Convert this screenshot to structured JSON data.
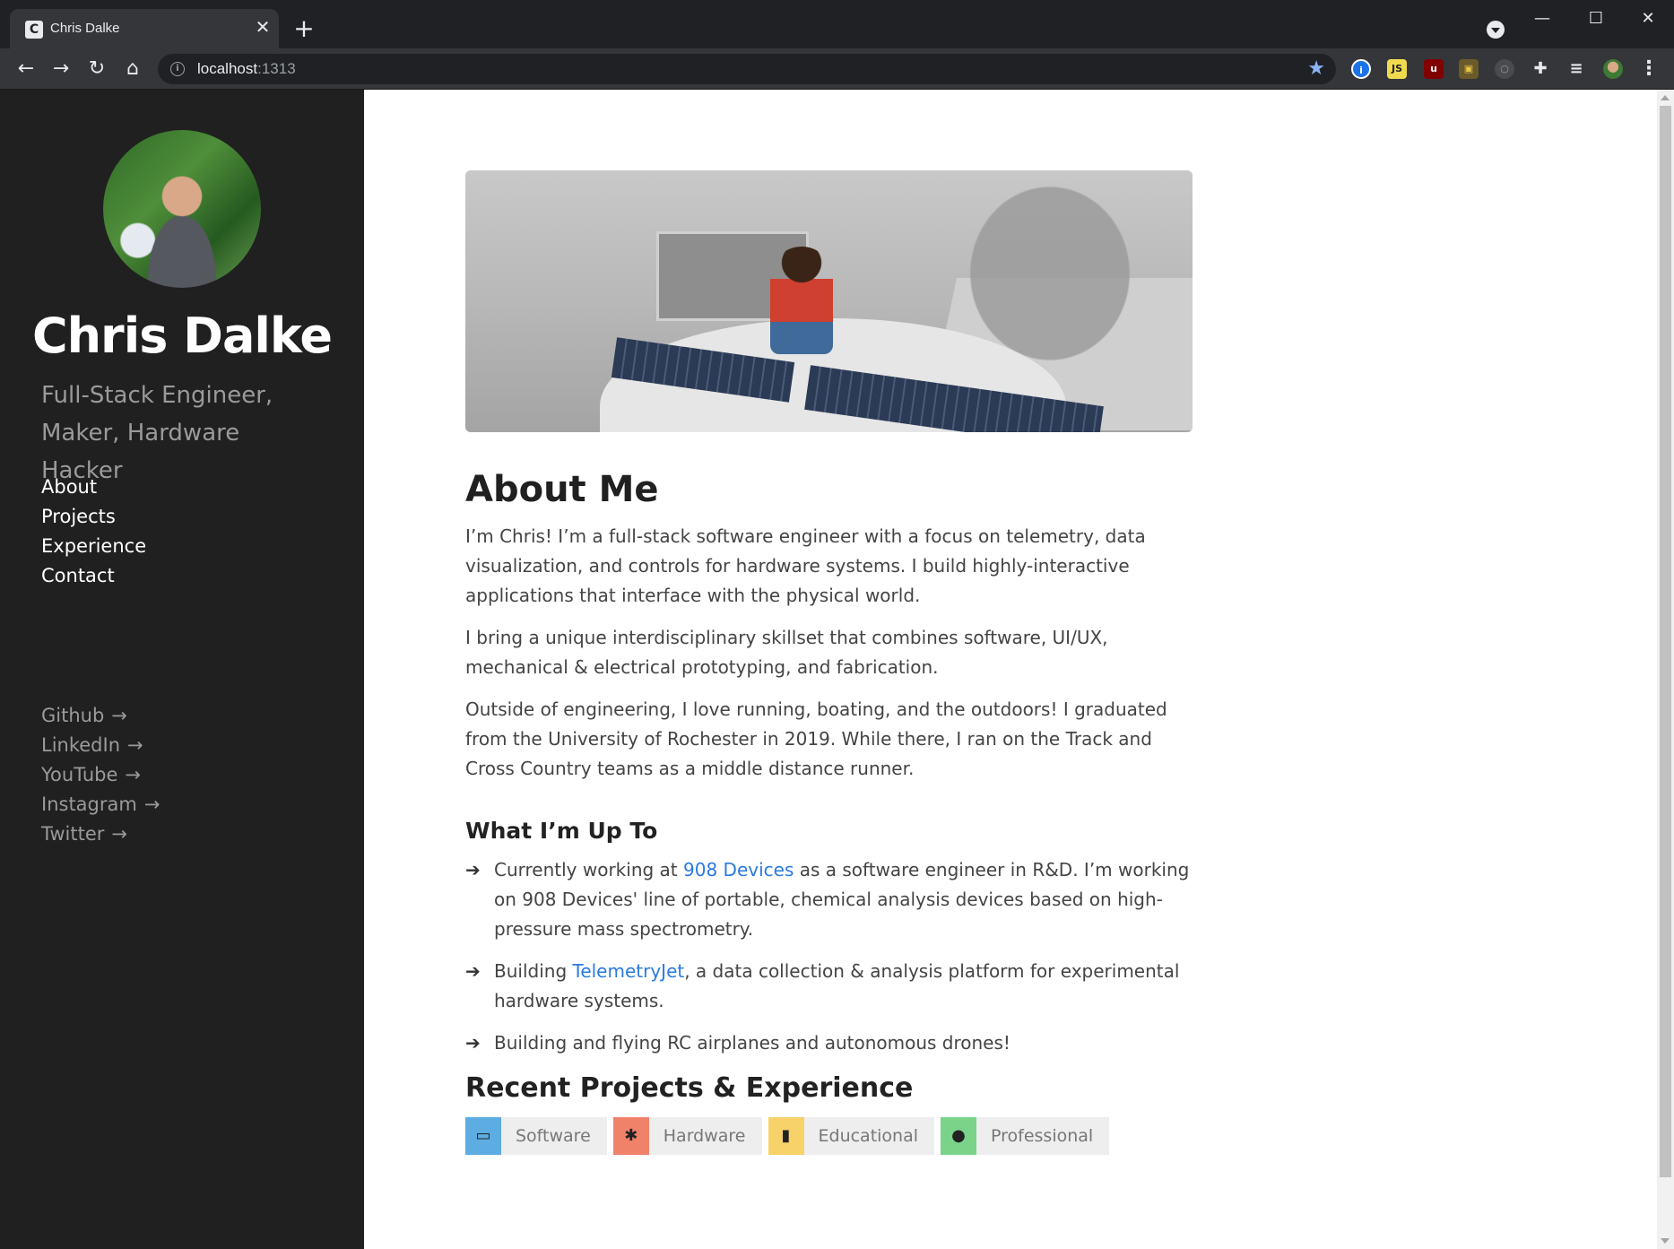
{
  "browser": {
    "tab_title": "Chris Dalke",
    "tab_favicon_letter": "C",
    "url_host": "localhost",
    "url_port": ":1313",
    "icons": {
      "close": "✕",
      "new_tab": "+",
      "back": "←",
      "forward": "→",
      "reload": "↻",
      "home": "⌂",
      "star": "★",
      "minimize": "—",
      "maximize": "☐",
      "window_close": "✕",
      "menu": "⋮"
    },
    "extensions": [
      "1password",
      "js",
      "ublock",
      "ext-house",
      "ext-search",
      "extensions-puzzle",
      "media-list",
      "profile"
    ]
  },
  "sidebar": {
    "name": "Chris Dalke",
    "tagline": "Full-Stack Engineer, Maker, Hardware Hacker",
    "nav": [
      {
        "label": "About"
      },
      {
        "label": "Projects"
      },
      {
        "label": "Experience"
      },
      {
        "label": "Contact"
      }
    ],
    "social_arrow": "→",
    "social": [
      {
        "label": "Github"
      },
      {
        "label": "LinkedIn"
      },
      {
        "label": "YouTube"
      },
      {
        "label": "Instagram"
      },
      {
        "label": "Twitter"
      }
    ]
  },
  "about": {
    "title": "About Me",
    "paragraphs": [
      "I’m Chris! I’m a full-stack software engineer with a focus on telemetry, data visualization, and controls for hardware systems. I build highly-interactive applications that interface with the physical world.",
      "I bring a unique interdisciplinary skillset that combines software, UI/UX, mechanical & electrical prototyping, and fabrication.",
      "Outside of engineering, I love running, boating, and the outdoors! I graduated from the University of Rochester in 2019. While there, I ran on the Track and Cross Country teams as a middle distance runner."
    ]
  },
  "upto": {
    "title": "What I’m Up To",
    "bullet": "➔",
    "items": [
      {
        "before": "Currently working at ",
        "link": "908 Devices",
        "after": " as a software engineer in R&D. I’m working on 908 Devices' line of portable, chemical analysis devices based on high-pressure mass spectrometry."
      },
      {
        "before": "Building ",
        "link": "TelemetryJet",
        "after": ", a data collection & analysis platform for experimental hardware systems."
      },
      {
        "before": "Building and flying RC airplanes and autonomous drones!",
        "link": "",
        "after": ""
      }
    ]
  },
  "recent": {
    "title": "Recent Projects & Experience",
    "tags": [
      {
        "label": "Software",
        "icon": "laptop-icon",
        "glyph": "▭",
        "color": "#5dade2"
      },
      {
        "label": "Hardware",
        "icon": "satellite-icon",
        "glyph": "✱",
        "color": "#f0826a"
      },
      {
        "label": "Educational",
        "icon": "book-icon",
        "glyph": "▮",
        "color": "#f7d268"
      },
      {
        "label": "Professional",
        "icon": "user-tie-icon",
        "glyph": "●",
        "color": "#7bd389"
      }
    ]
  },
  "colors": {
    "sidebar_bg": "#202020",
    "link": "#2a7ae2",
    "chrome_dark": "#202124",
    "chrome_toolbar": "#35363a"
  }
}
